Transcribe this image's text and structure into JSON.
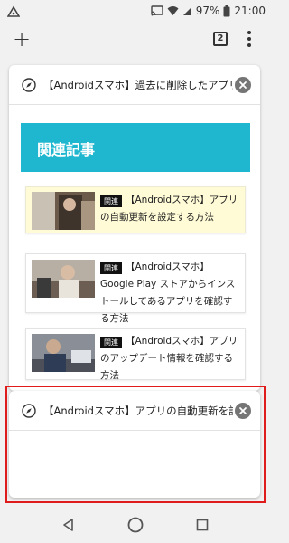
{
  "status_bar": {
    "battery": "97%",
    "time": "21:00"
  },
  "toolbar": {
    "tab_count": "2"
  },
  "tabs": [
    {
      "title": "【Androidスマホ】過去に削除したアプリを再インストールする方法",
      "related_heading": "関連記事",
      "articles": [
        {
          "tag": "関連",
          "title": "【Androidスマホ】アプリの自動更新を設定する方法",
          "highlighted": true
        },
        {
          "tag": "関連",
          "title": "【Androidスマホ】Google Play ストアからインストールしてあるアプリを確認する方法",
          "highlighted": false
        },
        {
          "tag": "関連",
          "title": "【Androidスマホ】アプリのアップデート情報を確認する方法",
          "highlighted": false
        }
      ]
    },
    {
      "title": "【Androidスマホ】アプリの自動更新を設定する方法"
    }
  ],
  "colors": {
    "accent": "#1fb7d0",
    "highlight_frame": "#e01b1b",
    "highlight_article_bg": "#fffbd6"
  }
}
